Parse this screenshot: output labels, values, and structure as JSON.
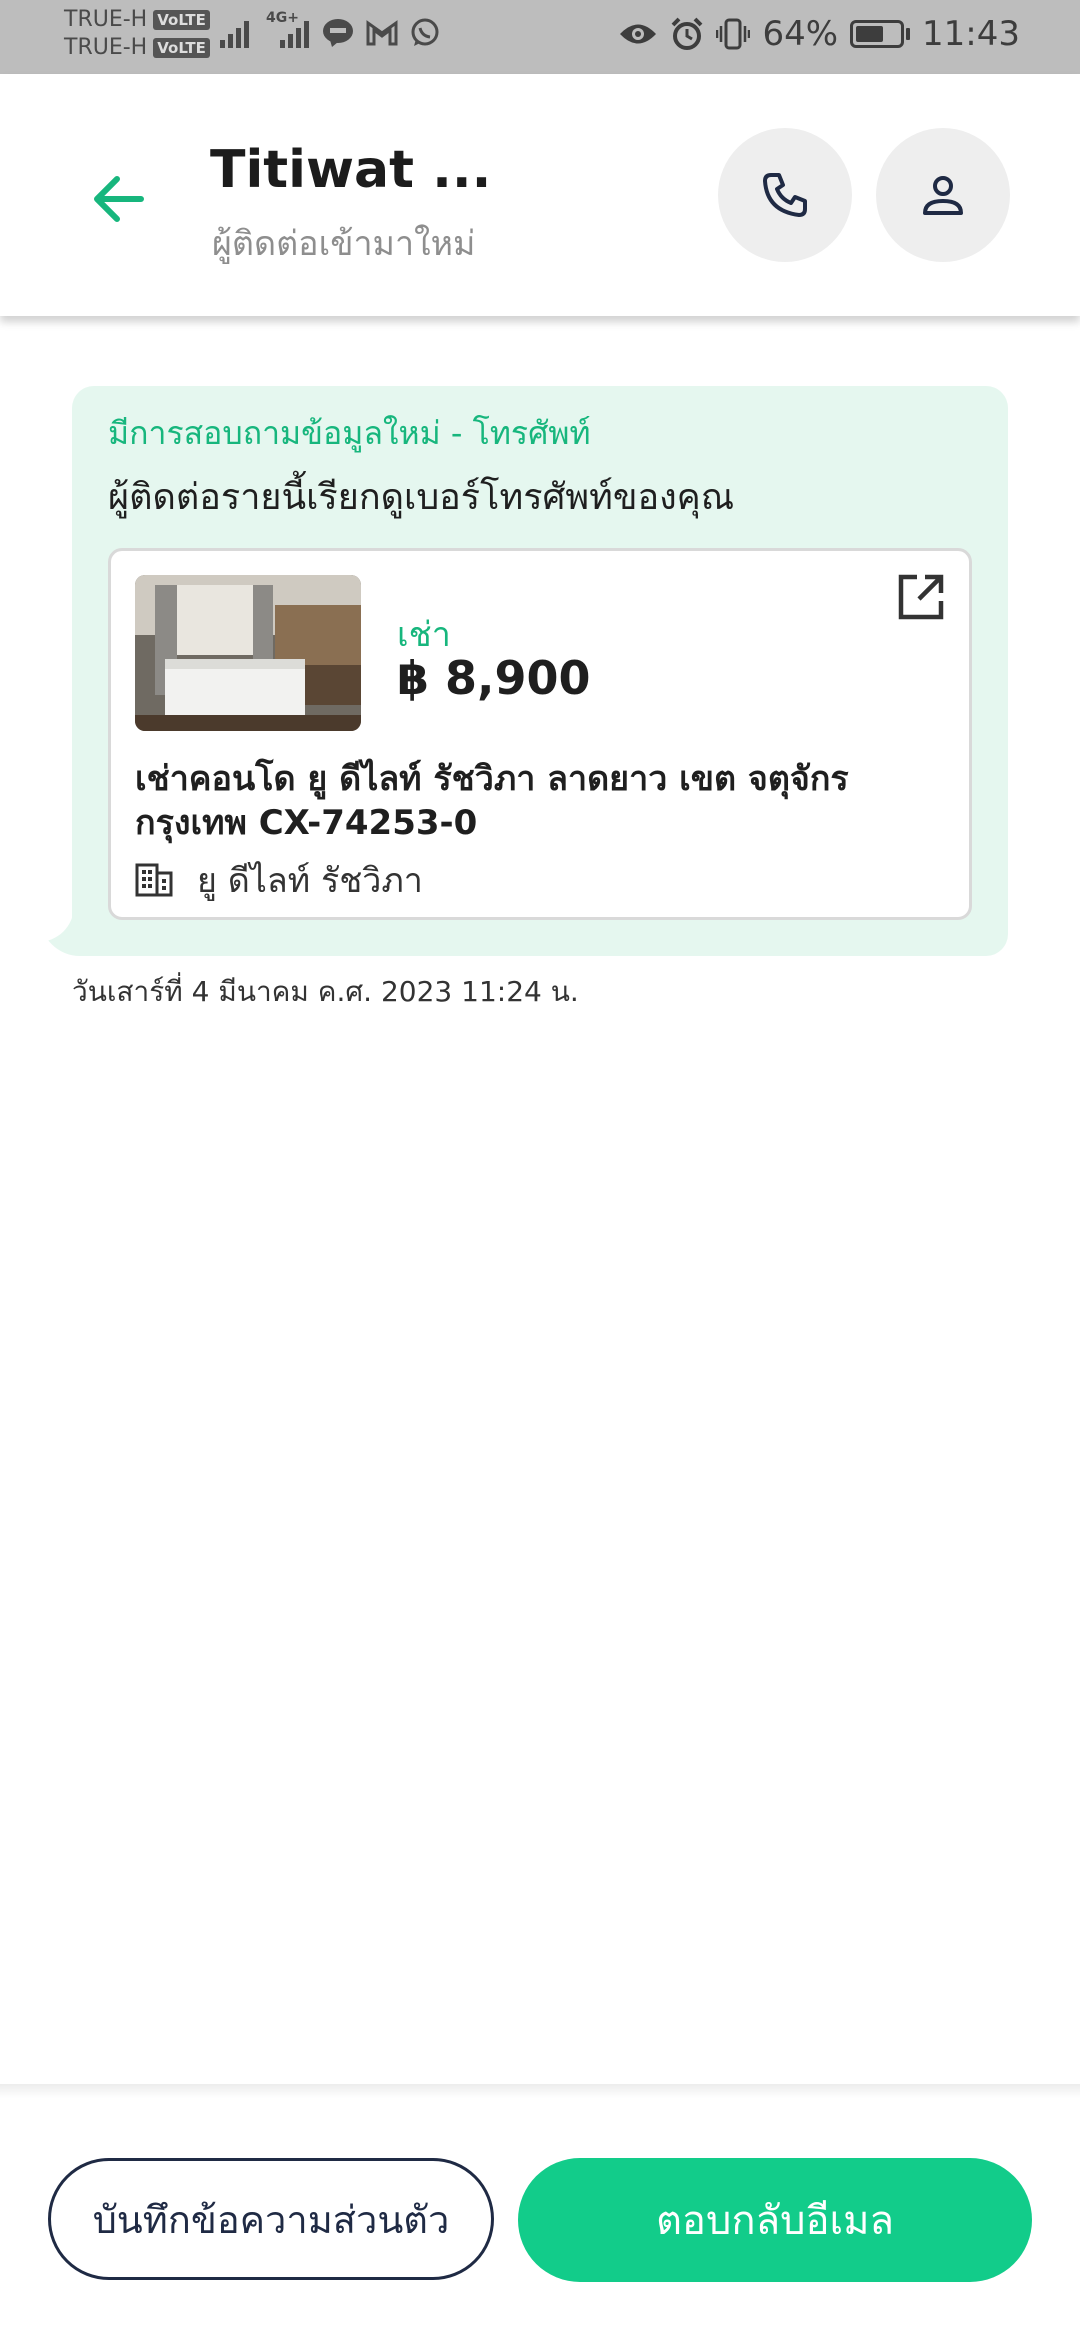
{
  "status_bar": {
    "carrier_1": "TRUE-H",
    "carrier_2": "TRUE-H",
    "volte_badge": "VoLTE",
    "network_label": "4G+",
    "battery_percent": "64%",
    "battery_level": 0.64,
    "time": "11:43",
    "icons": [
      "signal-icon",
      "signal-4g-icon",
      "line-app-icon",
      "gmail-icon",
      "whatsapp-icon",
      "eye-icon",
      "alarm-icon",
      "vibrate-icon",
      "battery-icon"
    ]
  },
  "header": {
    "contact_name": "Titiwat ...",
    "contact_status": "ผู้ติดต่อเข้ามาใหม่",
    "accent_color": "#17b67d"
  },
  "message": {
    "inquiry_title": "มีการสอบถามข้อมูลใหม่ - โทรศัพท์",
    "inquiry_body": "ผู้ติดต่อรายนี้เรียกดูเบอร์โทรศัพท์ของคุณ",
    "listing": {
      "type": "เช่า",
      "price": "฿ 8,900",
      "title": "เช่าคอนโด  ยู ดีไลท์ รัชวิภา ลาดยาว เขต จตุจักร กรุงเทพ CX-74253-0",
      "building": "ยู ดีไลท์ รัชวิภา"
    },
    "timestamp": "วันเสาร์ที่ 4 มีนาคม ค.ศ. 2023 11:24 น."
  },
  "actions": {
    "private_note_label": "บันทึกข้อความส่วนตัว",
    "reply_email_label": "ตอบกลับอีเมล",
    "reply_color": "#12cc8a"
  }
}
